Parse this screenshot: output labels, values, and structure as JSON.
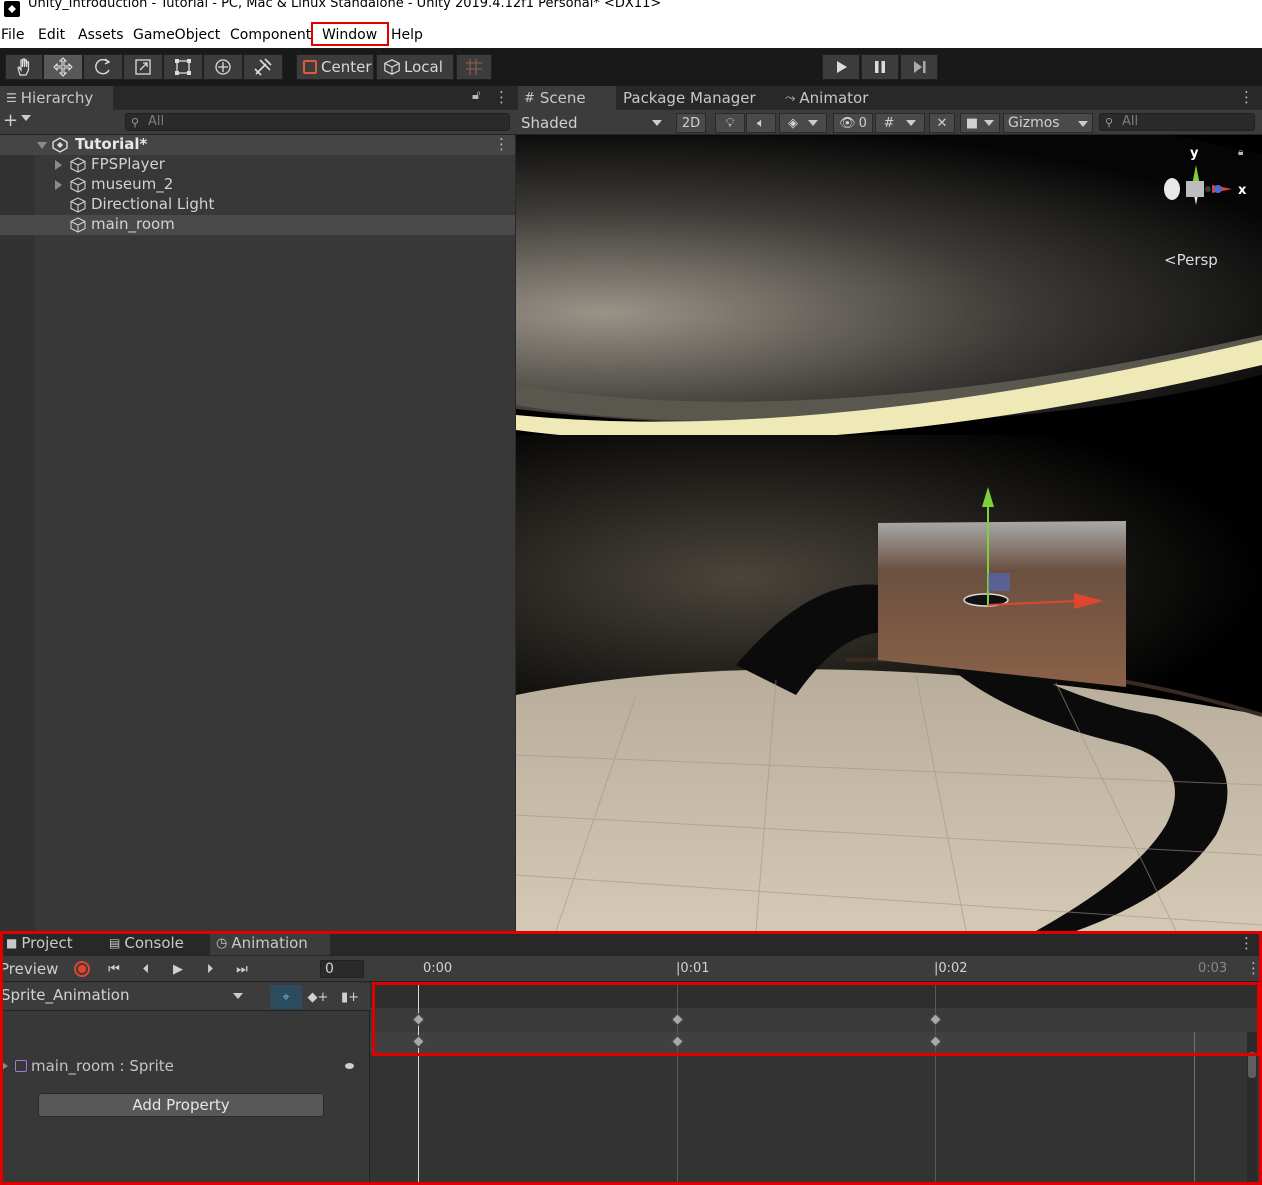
{
  "window": {
    "title": "Unity_Introduction - Tutorial - PC, Mac & Linux Standalone - Unity 2019.4.12f1 Personal* <DX11>"
  },
  "menu": {
    "items": [
      "File",
      "Edit",
      "Assets",
      "GameObject",
      "Component",
      "Window",
      "Help"
    ]
  },
  "toolbar": {
    "tools": [
      "hand-icon",
      "move-icon",
      "rotate-icon",
      "scale-icon",
      "rect-icon",
      "transform-icon",
      "custom-tool-icon"
    ],
    "pivot_label": "Center",
    "space_label": "Local",
    "play": "play-icon",
    "pause": "pause-icon",
    "step": "step-icon"
  },
  "hierarchy": {
    "tab_label": "Hierarchy",
    "search_placeholder": "All",
    "scene_name": "Tutorial*",
    "items": [
      {
        "label": "FPSPlayer",
        "expandable": true
      },
      {
        "label": "museum_2",
        "expandable": true
      },
      {
        "label": "Directional Light",
        "expandable": false
      },
      {
        "label": "main_room",
        "expandable": false,
        "selected": true
      }
    ]
  },
  "scene": {
    "tabs": [
      "Scene",
      "Package Manager",
      "Animator"
    ],
    "shading_mode": "Shaded",
    "mode_2d": "2D",
    "hidden_count": "0",
    "gizmos_label": "Gizmos",
    "search_placeholder": "All",
    "gizmo_axes": {
      "y": "y",
      "x": "x"
    },
    "projection_label": "Persp"
  },
  "bottom": {
    "tabs": [
      "Project",
      "Console",
      "Animation"
    ],
    "animation": {
      "preview_label": "Preview",
      "frame_value": "0",
      "clip_name": "Sprite_Animation",
      "property_label": "main_room : Sprite",
      "add_property_label": "Add Property",
      "timeline_ticks": [
        "0:00",
        "|0:01",
        "|0:02",
        "0:03"
      ]
    }
  },
  "colors": {
    "highlight_box": "#e00000",
    "record_button": "#e0462f",
    "panel_bg": "#383838"
  }
}
